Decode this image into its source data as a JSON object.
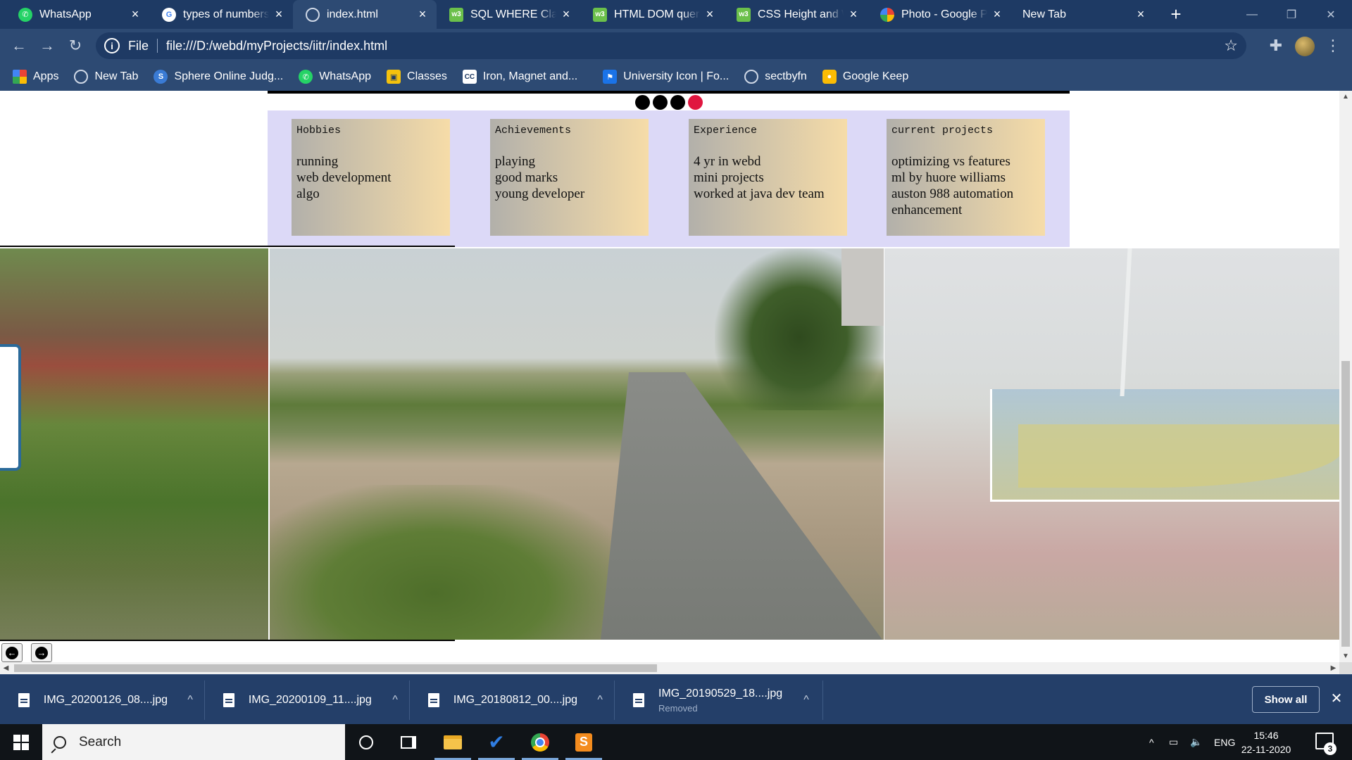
{
  "browser": {
    "tabs": [
      {
        "title": "WhatsApp",
        "icon": "whatsapp-icon",
        "active": false
      },
      {
        "title": "types of numbers",
        "icon": "google-icon",
        "active": false
      },
      {
        "title": "index.html",
        "icon": "globe-icon",
        "active": true
      },
      {
        "title": "SQL WHERE Clause",
        "icon": "w3schools-icon",
        "active": false
      },
      {
        "title": "HTML DOM query",
        "icon": "w3schools-icon",
        "active": false
      },
      {
        "title": "CSS Height and W",
        "icon": "w3schools-icon",
        "active": false
      },
      {
        "title": "Photo - Google Ph",
        "icon": "google-photos-icon",
        "active": false
      },
      {
        "title": "New Tab",
        "icon": "",
        "active": false
      }
    ],
    "new_tab_symbol": "+",
    "address": {
      "scheme_label": "File",
      "url": "file:///D:/webd/myProjects/iitr/index.html"
    },
    "bookmarks": [
      {
        "label": "Apps",
        "icon": "apps-grid-icon"
      },
      {
        "label": "New Tab",
        "icon": "globe-icon"
      },
      {
        "label": "Sphere Online Judg...",
        "icon": "spoj-icon"
      },
      {
        "label": "WhatsApp",
        "icon": "whatsapp-icon"
      },
      {
        "label": "Classes",
        "icon": "google-classroom-icon"
      },
      {
        "label": "Iron, Magnet and...",
        "icon": "cc-icon"
      },
      {
        "label": "University Icon | Fo...",
        "icon": "flag-icon"
      },
      {
        "label": "sectbyfn",
        "icon": "globe-icon"
      },
      {
        "label": "Google Keep",
        "icon": "google-keep-icon"
      }
    ]
  },
  "page": {
    "slide_count": 4,
    "active_slide": 4,
    "colors": {
      "dot_active": "#e0163f",
      "dot_inactive": "#000000",
      "card_strip_bg": "#dcd9f7"
    },
    "cards": [
      {
        "heading": "Hobbies",
        "lines": [
          "running",
          "web development",
          "algo"
        ]
      },
      {
        "heading": "Achievements",
        "lines": [
          "playing",
          "good marks",
          "young developer"
        ]
      },
      {
        "heading": "Experience",
        "lines": [
          "4 yr in webd",
          "mini projects",
          "worked at java dev team"
        ]
      },
      {
        "heading": "current projects",
        "lines": [
          "optimizing vs features",
          "ml by huore williams",
          "auston 988 automation",
          "enhancement"
        ]
      }
    ],
    "gallery_controls": {
      "prev_icon": "arrow-left-circle-icon",
      "next_icon": "arrow-right-circle-icon"
    }
  },
  "downloads": {
    "items": [
      {
        "name": "IMG_20200126_08....jpg",
        "status": ""
      },
      {
        "name": "IMG_20200109_11....jpg",
        "status": ""
      },
      {
        "name": "IMG_20180812_00....jpg",
        "status": ""
      },
      {
        "name": "IMG_20190529_18....jpg",
        "status": "Removed"
      }
    ],
    "show_all_label": "Show all"
  },
  "taskbar": {
    "search_placeholder": "Search",
    "language": "ENG",
    "time": "15:46",
    "date": "22-11-2020",
    "notification_count": "3"
  }
}
